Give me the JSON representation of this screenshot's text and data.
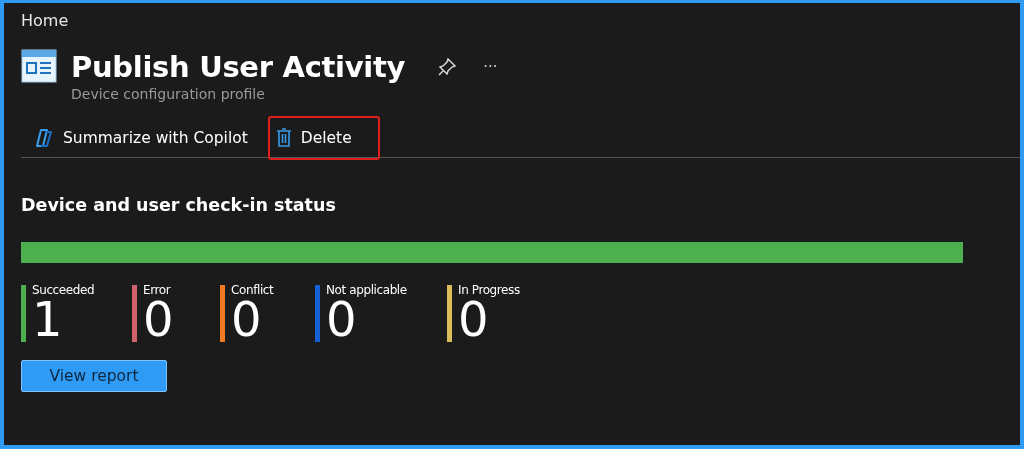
{
  "breadcrumb": "Home",
  "header": {
    "title": "Publish User Activity",
    "subtitle": "Device configuration profile",
    "more": "···"
  },
  "toolbar": [
    {
      "kind": "copilot",
      "label": "Summarize with Copilot",
      "highlighted": false
    },
    {
      "kind": "delete",
      "label": "Delete",
      "highlighted": true
    }
  ],
  "section": {
    "title": "Device and user check-in status",
    "bar": {
      "level": 1,
      "color": "#4caf50"
    }
  },
  "stats": [
    {
      "label": "Succeeded",
      "value": "1",
      "color": "#4caf50"
    },
    {
      "label": "Error",
      "value": "0",
      "color": "#d2636d"
    },
    {
      "label": "Conflict",
      "value": "0",
      "color": "#f07a24"
    },
    {
      "label": "Not applicable",
      "value": "0",
      "color": "#1560d4"
    },
    {
      "label": "In Progress",
      "value": "0",
      "color": "#d8bd5a"
    }
  ],
  "button": "View report"
}
